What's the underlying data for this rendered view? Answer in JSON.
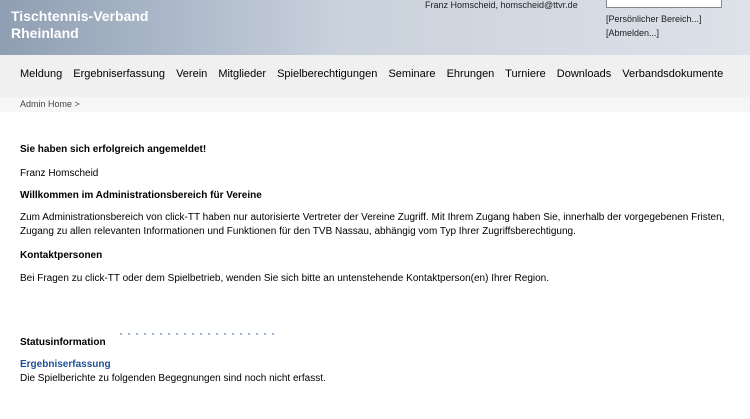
{
  "header": {
    "logo_line1": "Tischtennis-Verband",
    "logo_line2": "Rheinland",
    "user_info": "Franz Homscheid, homscheid@ttvr.de",
    "links": [
      "[Persönlicher Bereich...]",
      "[Abmelden...]"
    ]
  },
  "nav": {
    "items": [
      "Meldung",
      "Ergebniserfassung",
      "Verein",
      "Mitglieder",
      "Spielberechtigungen",
      "Seminare",
      "Ehrungen",
      "Turniere",
      "Downloads",
      "Verbandsdokumente"
    ]
  },
  "breadcrumb": "Admin Home >",
  "main": {
    "success": "Sie haben sich erfolgreich angemeldet!",
    "user_name": "Franz Homscheid",
    "welcome_title": "Willkommen im Administrationsbereich für Vereine",
    "welcome_text": "Zum Administrationsbereich von click-TT haben nur autorisierte Vertreter der Vereine Zugriff. Mit Ihrem Zugang haben Sie, innerhalb der vorgegebenen Fristen, Zugang zu allen relevanten Informationen und Funktionen für den TVB Nassau, abhängig vom Typ Ihrer Zugriffsberechtigung.",
    "contact_title": "Kontaktpersonen",
    "contact_text": "Bei Fragen zu click-TT  oder dem Spielbetrieb, wenden Sie sich bitte an untenstehende Kontaktperson(en)  Ihrer Region.",
    "status_title": "Statusinformation",
    "result_link": "Ergebniserfassung",
    "result_text": "Die Spielberichte zu folgenden Begegnungen sind noch nicht erfasst."
  }
}
